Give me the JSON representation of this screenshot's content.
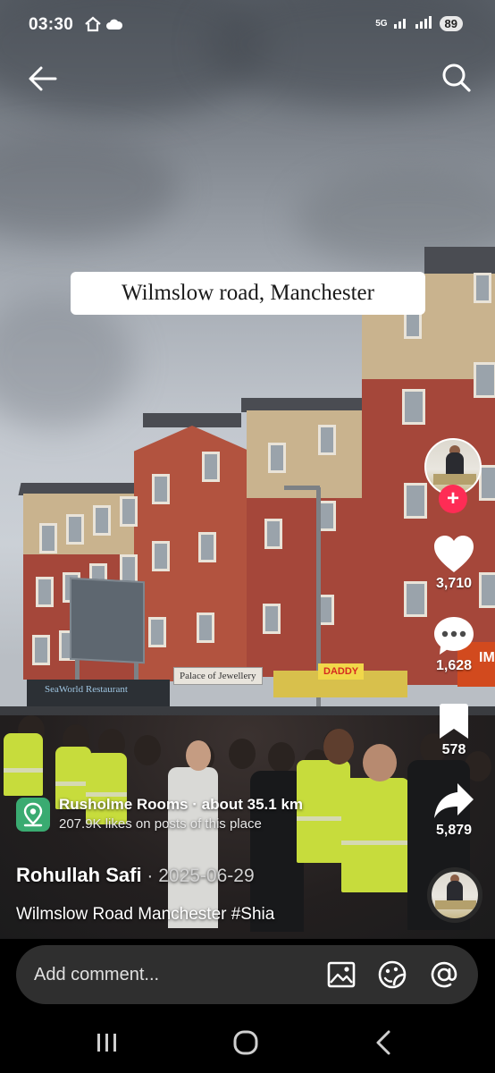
{
  "status_bar": {
    "time": "03:30",
    "network": "5G",
    "battery": "89",
    "icons": [
      "house-icon",
      "cloud-house-icon",
      "signal-icon",
      "wifi-signal-icon"
    ]
  },
  "video": {
    "caption_overlay": "Wilmslow road, Manchester",
    "shop_signs": [
      "SeaWorld Restaurant",
      "Palace of Jewellery",
      "DADDY",
      "IM"
    ]
  },
  "rail": {
    "likes": "3,710",
    "comments": "1,628",
    "saves": "578",
    "shares": "5,879",
    "follow_symbol": "+"
  },
  "place": {
    "name": "Rusholme Rooms",
    "separator": " · ",
    "distance": "about 35.1 km",
    "subtitle": "207.9K likes on posts of this place"
  },
  "post": {
    "author": "Rohullah Safi",
    "date": " · 2025-06-29",
    "description": "Wilmslow Road Manchester #Shia"
  },
  "comment_bar": {
    "placeholder": "Add comment...",
    "icons": [
      "image-icon",
      "sticker-icon",
      "mention-icon"
    ]
  },
  "colors": {
    "accent": "#fe2c55",
    "place_icon": "#3aab71",
    "comment_bar_bg": "#2f2f2f"
  }
}
